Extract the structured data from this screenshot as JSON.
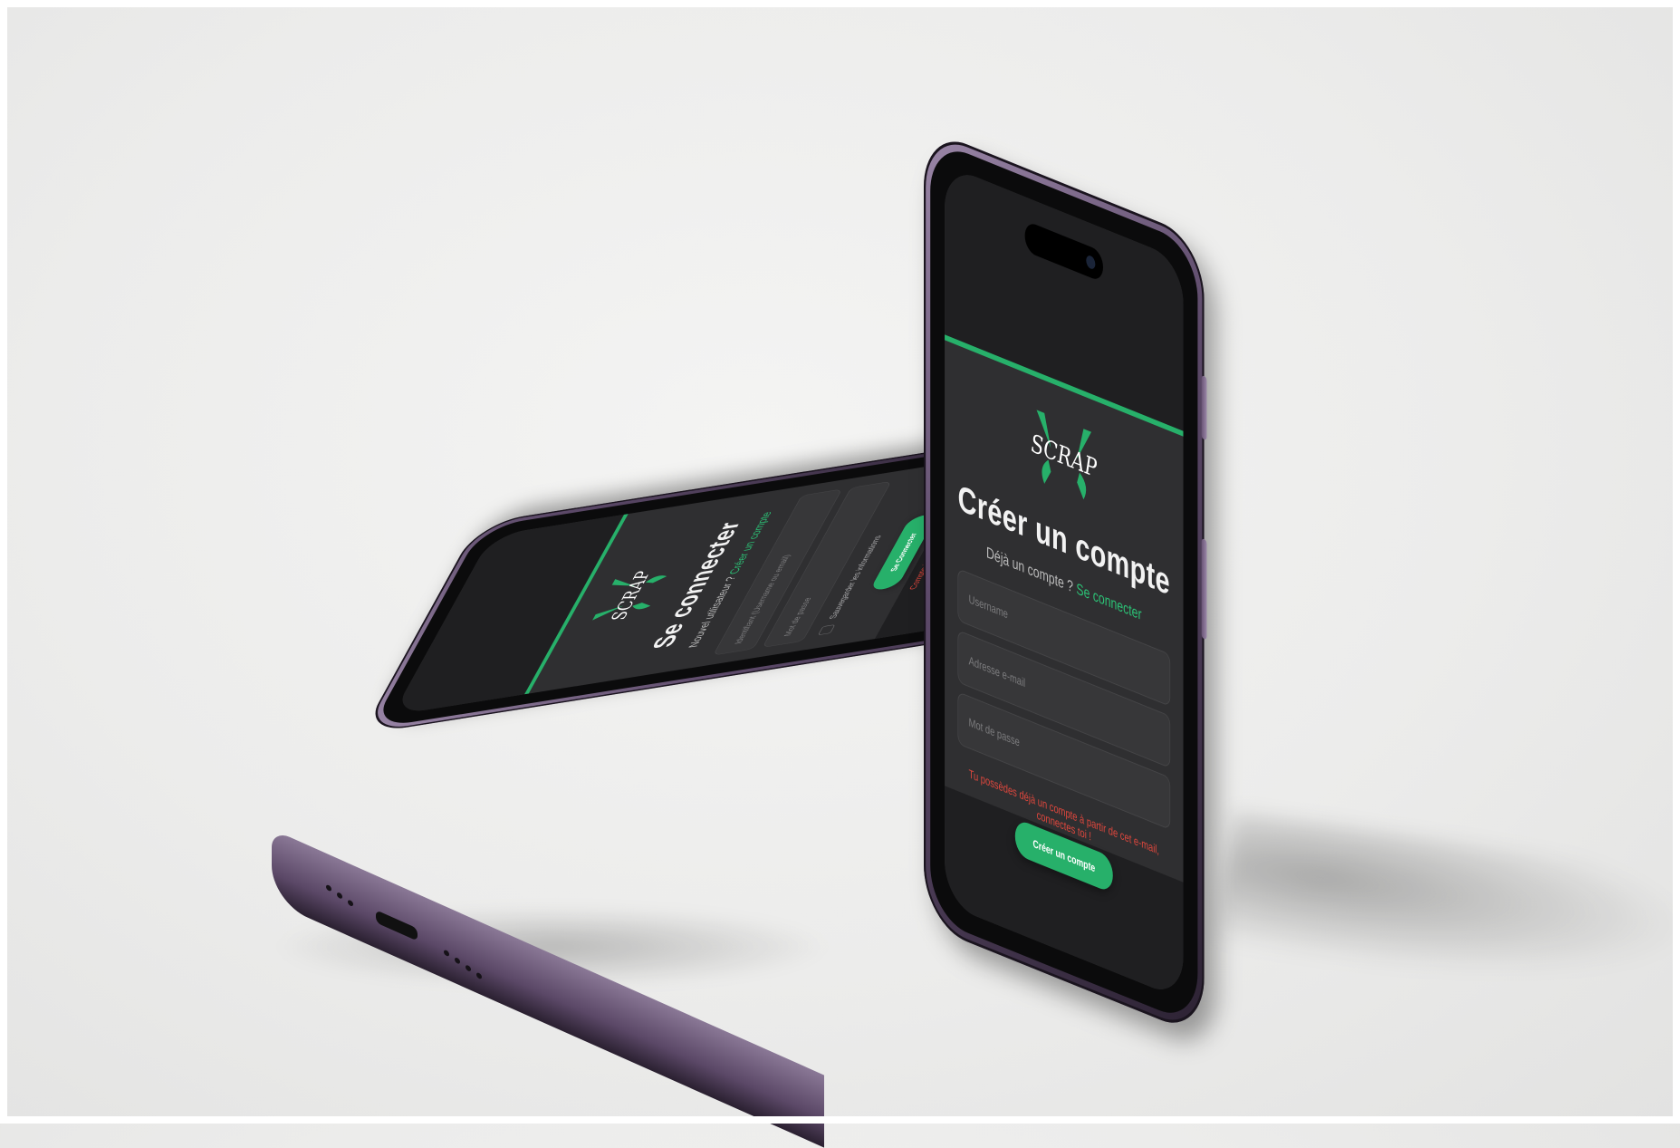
{
  "phone_front": {
    "title": "Créer un compte",
    "subline_prefix": "Déjà un compte ?",
    "subline_link": "Se connecter",
    "fields": [
      {
        "placeholder": "Username"
      },
      {
        "placeholder": "Adresse e-mail"
      },
      {
        "placeholder": "Mot de passe"
      }
    ],
    "error": "Tu possèdes déjà un compte à partir de cet e-mail, connectes toi !",
    "button": "Créer un compte"
  },
  "phone_back": {
    "title": "Se connecter",
    "subline_prefix": "Nouvel utilisateur ?",
    "subline_link": "Créer un compte",
    "fields": [
      {
        "placeholder": "Identifiant (Username ou email)"
      },
      {
        "placeholder": "Mot de passe"
      }
    ],
    "checkbox_label": "Sauvegarder les informations",
    "button": "Se Connecter",
    "error": "Compte inexistant, inscris toi !"
  },
  "logo": {
    "text": "SCRAP"
  },
  "colors": {
    "accent": "#27b06a",
    "error": "#e0473d",
    "screen": "#2f2f31",
    "frame": "#5d4a6a"
  }
}
